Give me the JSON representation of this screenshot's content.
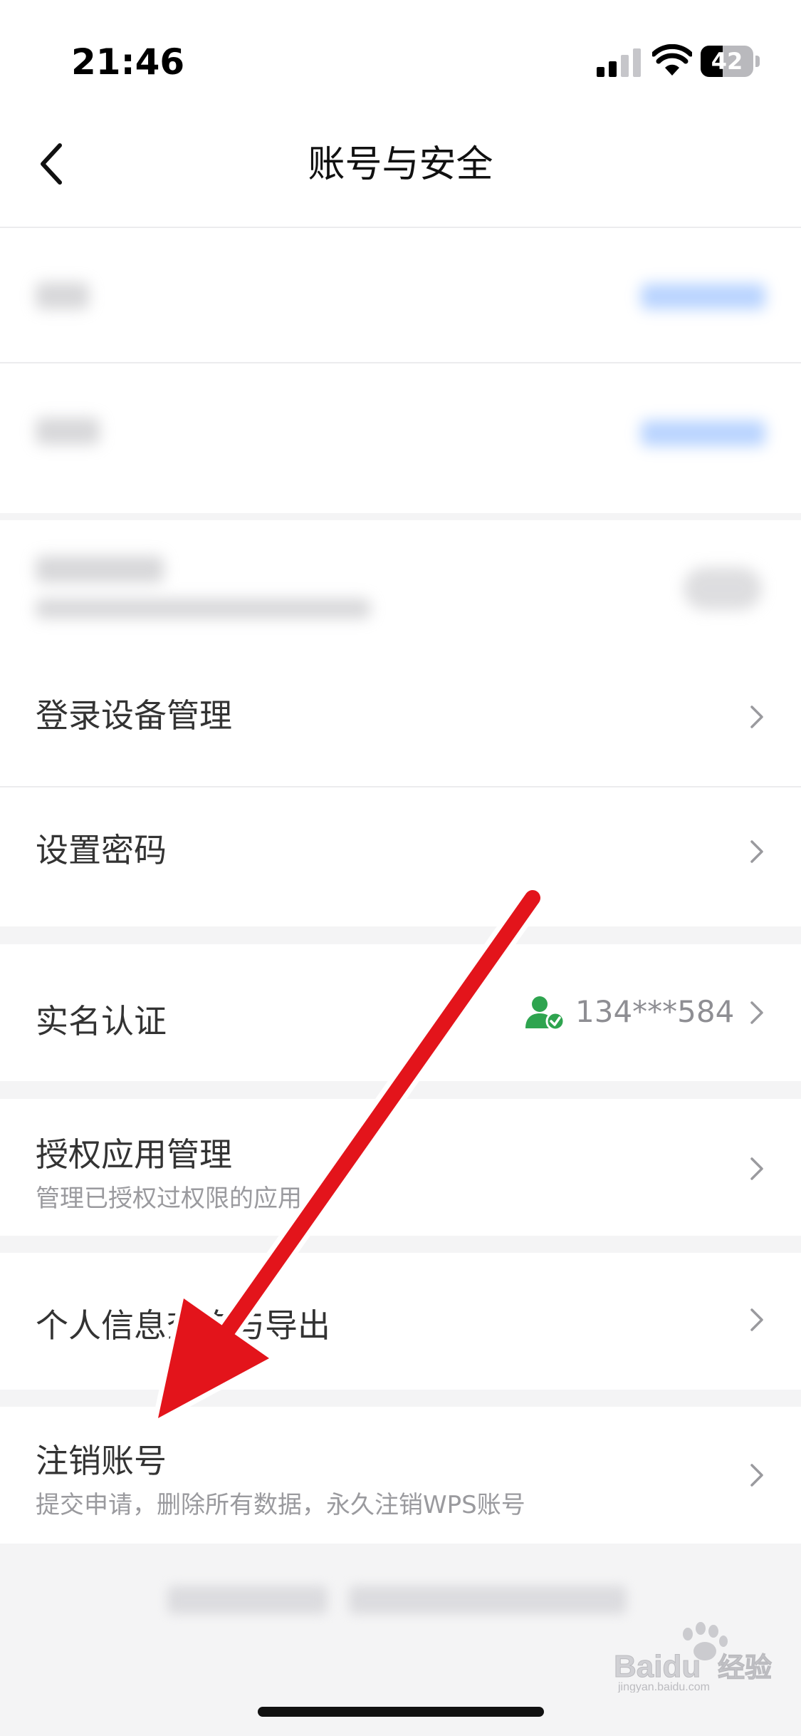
{
  "status_bar": {
    "time": "21:46",
    "battery_level": "42",
    "battery_fraction": 0.42
  },
  "header": {
    "title": "账号与安全",
    "back_icon": "chevron-left-icon"
  },
  "settings": {
    "login_devices": {
      "title": "登录设备管理"
    },
    "set_password": {
      "title": "设置密码"
    },
    "real_name": {
      "title": "实名认证",
      "value": "134***584",
      "status_icon": "verified-user-icon",
      "status_color": "#2ea44f"
    },
    "authorized_apps": {
      "title": "授权应用管理",
      "subtitle": "管理已授权过权限的应用"
    },
    "personal_info": {
      "title": "个人信息查询与导出"
    },
    "delete_account": {
      "title": "注销账号",
      "subtitle": "提交申请，删除所有数据，永久注销WPS账号"
    }
  },
  "watermark": {
    "brand": "Baidu",
    "suffix": "经验",
    "url": "jingyan.baidu.com"
  },
  "colors": {
    "accent_blue": "#3478f6",
    "annotation_arrow": "#e3141b",
    "verified_green": "#2ea44f"
  }
}
